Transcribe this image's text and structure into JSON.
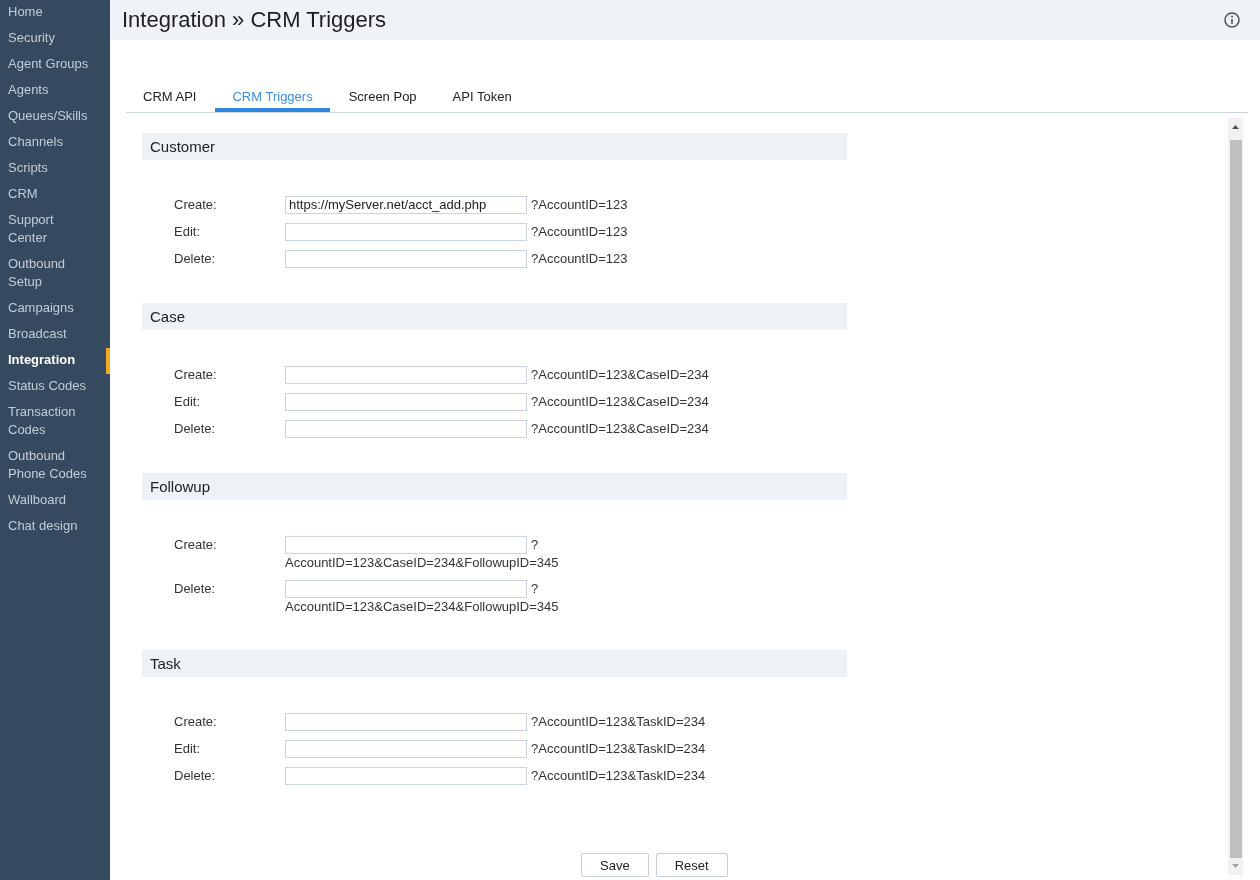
{
  "sidebar": {
    "items": [
      {
        "label": "Home",
        "selected": false
      },
      {
        "label": "Security",
        "selected": false
      },
      {
        "label": "Agent Groups",
        "selected": false
      },
      {
        "label": "Agents",
        "selected": false
      },
      {
        "label": "Queues/Skills",
        "selected": false
      },
      {
        "label": "Channels",
        "selected": false
      },
      {
        "label": "Scripts",
        "selected": false
      },
      {
        "label": "CRM",
        "selected": false
      },
      {
        "label": "Support Center",
        "selected": false
      },
      {
        "label": "Outbound Setup",
        "selected": false
      },
      {
        "label": "Campaigns",
        "selected": false
      },
      {
        "label": "Broadcast",
        "selected": false
      },
      {
        "label": "Integration",
        "selected": true
      },
      {
        "label": "Status Codes",
        "selected": false
      },
      {
        "label": "Transaction Codes",
        "selected": false
      },
      {
        "label": "Outbound Phone Codes",
        "selected": false
      },
      {
        "label": "Wallboard",
        "selected": false
      },
      {
        "label": "Chat design",
        "selected": false
      }
    ]
  },
  "header": {
    "title": "Integration » CRM Triggers"
  },
  "tabs": [
    {
      "label": "CRM API",
      "selected": false
    },
    {
      "label": "CRM Triggers",
      "selected": true
    },
    {
      "label": "Screen Pop",
      "selected": false
    },
    {
      "label": "API Token",
      "selected": false
    }
  ],
  "sections": [
    {
      "title": "Customer",
      "rows": [
        {
          "label": "Create:",
          "value": "https://myServer.net/acct_add.php",
          "suffix": "?AccountID=123"
        },
        {
          "label": "Edit:",
          "suffix": "?AccountID=123"
        },
        {
          "label": "Delete:",
          "suffix": "?AccountID=123"
        }
      ]
    },
    {
      "title": "Case",
      "rows": [
        {
          "label": "Create:",
          "suffix": "?AccountID=123&CaseID=234"
        },
        {
          "label": "Edit:",
          "suffix": "?AccountID=123&CaseID=234"
        },
        {
          "label": "Delete:",
          "suffix": "?AccountID=123&CaseID=234"
        }
      ]
    },
    {
      "title": "Followup",
      "rows": [
        {
          "label": "Create:",
          "suffix": "?",
          "suffix_continued": "AccountID=123&CaseID=234&FollowupID=345"
        },
        {
          "label": "Delete:",
          "suffix": "?",
          "suffix_continued": "AccountID=123&CaseID=234&FollowupID=345"
        }
      ]
    },
    {
      "title": "Task",
      "rows": [
        {
          "label": "Create:",
          "suffix": "?AccountID=123&TaskID=234"
        },
        {
          "label": "Edit:",
          "suffix": "?AccountID=123&TaskID=234"
        },
        {
          "label": "Delete:",
          "suffix": "?AccountID=123&TaskID=234"
        }
      ]
    }
  ],
  "buttons": [
    "Save",
    "Reset"
  ]
}
